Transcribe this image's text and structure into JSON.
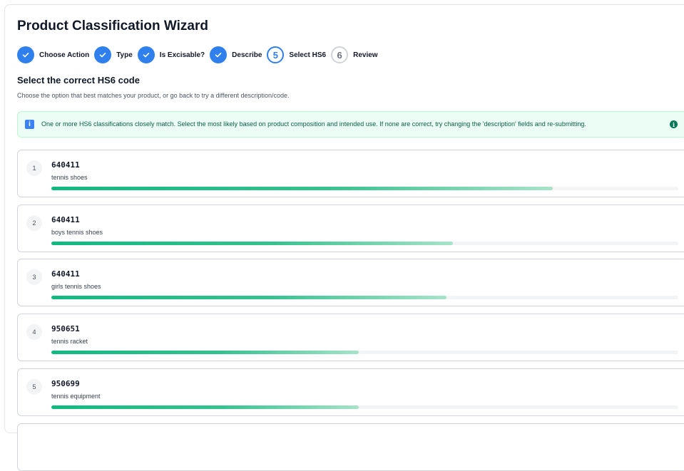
{
  "page": {
    "title": "Product Classification Wizard"
  },
  "steps": [
    {
      "label": "Choose Action",
      "state": "done"
    },
    {
      "label": "Type",
      "state": "done"
    },
    {
      "label": "Is Excisable?",
      "state": "done"
    },
    {
      "label": "Describe",
      "state": "done"
    },
    {
      "label": "Select HS6",
      "state": "active",
      "number": "5"
    },
    {
      "label": "Review",
      "state": "todo",
      "number": "6"
    }
  ],
  "section": {
    "title": "Select the correct HS6 code",
    "description": "Choose the option that best matches your product, or go back to try a different description/code."
  },
  "alert": {
    "icon": "info-square-icon",
    "text": "One or more HS6 classifications closely match. Select the most likely based on product composition and intended use. If none are correct, try changing the 'description' fields and re-submitting.",
    "info_icon": "info-circle-icon"
  },
  "options": [
    {
      "rank": "1",
      "code": "640411",
      "description": "tennis shoes",
      "match": 0.8
    },
    {
      "rank": "2",
      "code": "640411",
      "description": "boys tennis shoes",
      "match": 0.64
    },
    {
      "rank": "3",
      "code": "640411",
      "description": "girls tennis shoes",
      "match": 0.63
    },
    {
      "rank": "4",
      "code": "950651",
      "description": "tennis racket",
      "match": 0.49
    },
    {
      "rank": "5",
      "code": "950699",
      "description": "tennis equipment",
      "match": 0.49
    }
  ],
  "colors": {
    "primary": "#2f80ed",
    "success": "#10b981",
    "alert_bg": "#ecfdf5"
  }
}
